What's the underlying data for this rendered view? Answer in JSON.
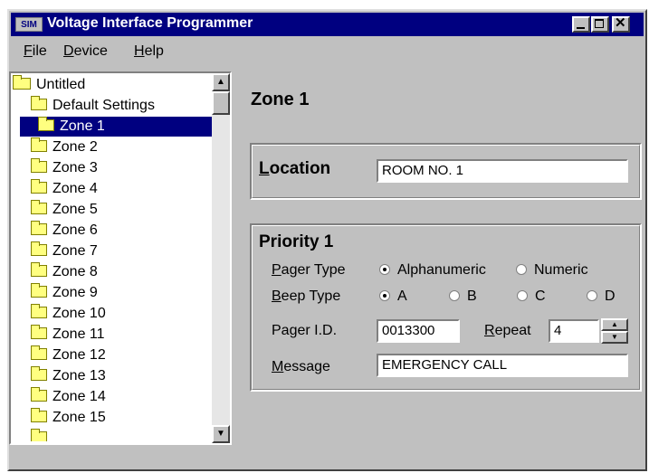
{
  "window": {
    "title": "Voltage Interface Programmer",
    "app_icon_text": "SIM"
  },
  "menu": [
    {
      "label": "File"
    },
    {
      "label": "Device"
    },
    {
      "label": "Help"
    }
  ],
  "tree": {
    "root": "Untitled",
    "items": [
      {
        "label": "Default Settings"
      },
      {
        "label": "Zone 1",
        "selected": true
      },
      {
        "label": "Zone 2"
      },
      {
        "label": "Zone 3"
      },
      {
        "label": "Zone 4"
      },
      {
        "label": "Zone 5"
      },
      {
        "label": "Zone 6"
      },
      {
        "label": "Zone 7"
      },
      {
        "label": "Zone 8"
      },
      {
        "label": "Zone 9"
      },
      {
        "label": "Zone 10"
      },
      {
        "label": "Zone 11"
      },
      {
        "label": "Zone 12"
      },
      {
        "label": "Zone 13"
      },
      {
        "label": "Zone 14"
      },
      {
        "label": "Zone 15"
      }
    ]
  },
  "detail": {
    "title": "Zone 1",
    "location": {
      "label": "Location",
      "value": "ROOM NO. 1"
    },
    "priority": {
      "title": "Priority 1",
      "pager_type": {
        "label": "Pager Type",
        "options": [
          "Alphanumeric",
          "Numeric"
        ],
        "selected": "Alphanumeric"
      },
      "beep_type": {
        "label": "Beep Type",
        "options": [
          "A",
          "B",
          "C",
          "D"
        ],
        "selected": "A"
      },
      "pager_id": {
        "label": "Pager I.D.",
        "value": "0013300"
      },
      "repeat": {
        "label": "Repeat",
        "value": "4"
      },
      "message": {
        "label": "Message",
        "value": "EMERGENCY CALL"
      }
    }
  },
  "colors": {
    "titlebar": "#000080",
    "face": "#c0c0c0",
    "selection": "#000080"
  }
}
